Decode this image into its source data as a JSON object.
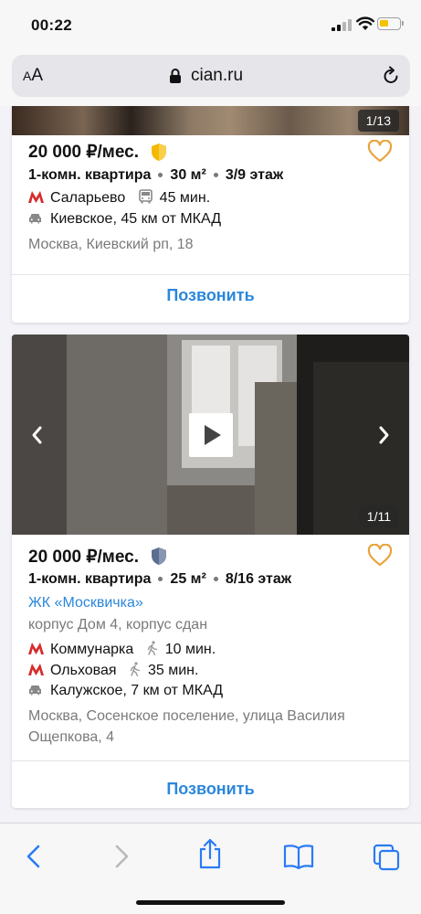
{
  "status_bar": {
    "time": "00:22"
  },
  "browser": {
    "aa_label_small": "A",
    "aa_label_big": "A",
    "url": "cian.ru"
  },
  "listings": [
    {
      "photo_counter": "1/13",
      "price": "20 000 ₽/мес.",
      "verified_badge_color": "#f5b800",
      "rooms": "1-комн. квартира",
      "area": "30 м²",
      "floor": "3/9 этаж",
      "metro": {
        "station": "Саларьево",
        "mode": "bus",
        "time": "45 мин."
      },
      "highway": "Киевское, 45 км от МКАД",
      "address": "Москва, Киевский рп, 18",
      "call_label": "Позвонить"
    },
    {
      "photo_counter": "1/11",
      "price": "20 000 ₽/мес.",
      "verified_badge_color": "#5c6e8f",
      "rooms": "1-комн. квартира",
      "area": "25 м²",
      "floor": "8/16 этаж",
      "complex": "ЖК «Москвичка»",
      "building": "корпус Дом 4, корпус сдан",
      "metros": [
        {
          "station": "Коммунарка",
          "mode": "walk",
          "time": "10 мин."
        },
        {
          "station": "Ольховая",
          "mode": "walk",
          "time": "35 мин."
        }
      ],
      "highway": "Калужское, 7 км от МКАД",
      "address": "Москва, Сосенское поселение, улица Василия Ощепкова, 4",
      "call_label": "Позвонить"
    }
  ],
  "toolbar": {
    "items": [
      "back-icon",
      "forward-icon",
      "share-icon",
      "bookmarks-icon",
      "tabs-icon"
    ]
  },
  "colors": {
    "accent": "#2b87db",
    "metro_red": "#d72c2c",
    "heart": "#e8a33a",
    "ios_blue": "#2a7bf5"
  }
}
